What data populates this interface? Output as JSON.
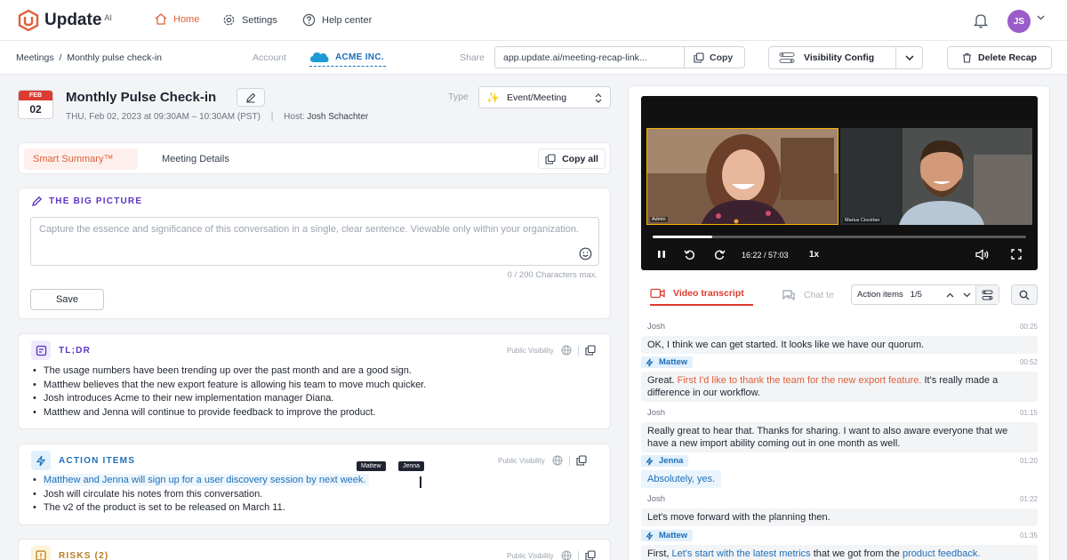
{
  "app": {
    "name": "Update",
    "sup": "AI"
  },
  "nav": {
    "home": "Home",
    "settings": "Settings",
    "help": "Help center"
  },
  "user": {
    "initials": "JS"
  },
  "breadcrumb": "Meetings  /  Monthly pulse check-in",
  "account": {
    "label": "Account",
    "name": "ACME INC."
  },
  "share": {
    "label": "Share",
    "url": "app.update.ai/meeting-recap-link...",
    "copy": "Copy"
  },
  "buttons": {
    "visibility": "Visibility Config",
    "delete": "Delete Recap",
    "copy_all": "Copy all",
    "save": "Save"
  },
  "meeting": {
    "month": "FEB",
    "day": "02",
    "title": "Monthly Pulse Check-in",
    "datetime": "THU, Feb 02, 2023 at 09:30AM – 10:30AM (PST)",
    "host_label": "Host:",
    "host": "Josh Schachter",
    "type_label": "Type",
    "type_value": "Event/Meeting"
  },
  "tabs": {
    "active": "Smart Summary™",
    "other": "Meeting Details"
  },
  "big_picture": {
    "heading": "THE BIG PICTURE",
    "placeholder": "Capture the essence and significance of this conversation in a single, clear sentence. Viewable only within your organization.",
    "char_count": "0 / 200 Characters max."
  },
  "tldr": {
    "heading": "TL;DR",
    "visibility": "Public Visibility",
    "items": [
      "The usage numbers have been trending up over the past month and are a good sign.",
      "Matthew believes that the new export feature is allowing his team to move much quicker.",
      "Josh introduces Acme to their new implementation manager Diana.",
      "Matthew and Jenna will continue to provide feedback to improve the product."
    ]
  },
  "action_items": {
    "heading": "ACTION ITEMS",
    "visibility": "Public Visibility",
    "tags": [
      "Mattew",
      "Jenna"
    ],
    "items": [
      "Matthew and Jenna will sign up for a user discovery session by next week.",
      "Josh will circulate his notes from this conversation.",
      "The v2 of the product is set to be released on March 11."
    ]
  },
  "risks": {
    "heading": "RISKS (2)",
    "visibility": "Public Visibility"
  },
  "video": {
    "participants": [
      "Admin",
      "Marius Ciocirlan"
    ],
    "time": "16:22 / 57:03",
    "speed": "1x",
    "progress": 0.16
  },
  "transcript": {
    "tab": "Video transcript",
    "chat_tab": "Chat te",
    "finder_label": "Action items",
    "finder_count": "1/5",
    "messages": [
      {
        "speaker": "Josh",
        "time": "00:25",
        "text": "OK, I think we can get started. It looks like we have our quorum."
      },
      {
        "speaker": "Mattew",
        "time": "00:52",
        "pre": "Great. ",
        "hl": "First I'd like to thank the team for the new export feature.",
        "post": " It's really made a difference in our workflow."
      },
      {
        "speaker": "Josh",
        "time": "01:15",
        "text": "Really great to hear that. Thanks for sharing. I want to also aware everyone that we have a new import ability coming out in one month as well."
      },
      {
        "speaker": "Jenna",
        "time": "01:20",
        "text": "Absolutely, yes."
      },
      {
        "speaker": "Josh",
        "time": "01:22",
        "text": "Let's move forward with the planning then."
      },
      {
        "speaker": "Mattew",
        "time": "01:35",
        "pre": "First, ",
        "hl": "Let's start with the latest metrics",
        "mid": " that we got from the ",
        "hl2": "product feedback."
      }
    ]
  }
}
